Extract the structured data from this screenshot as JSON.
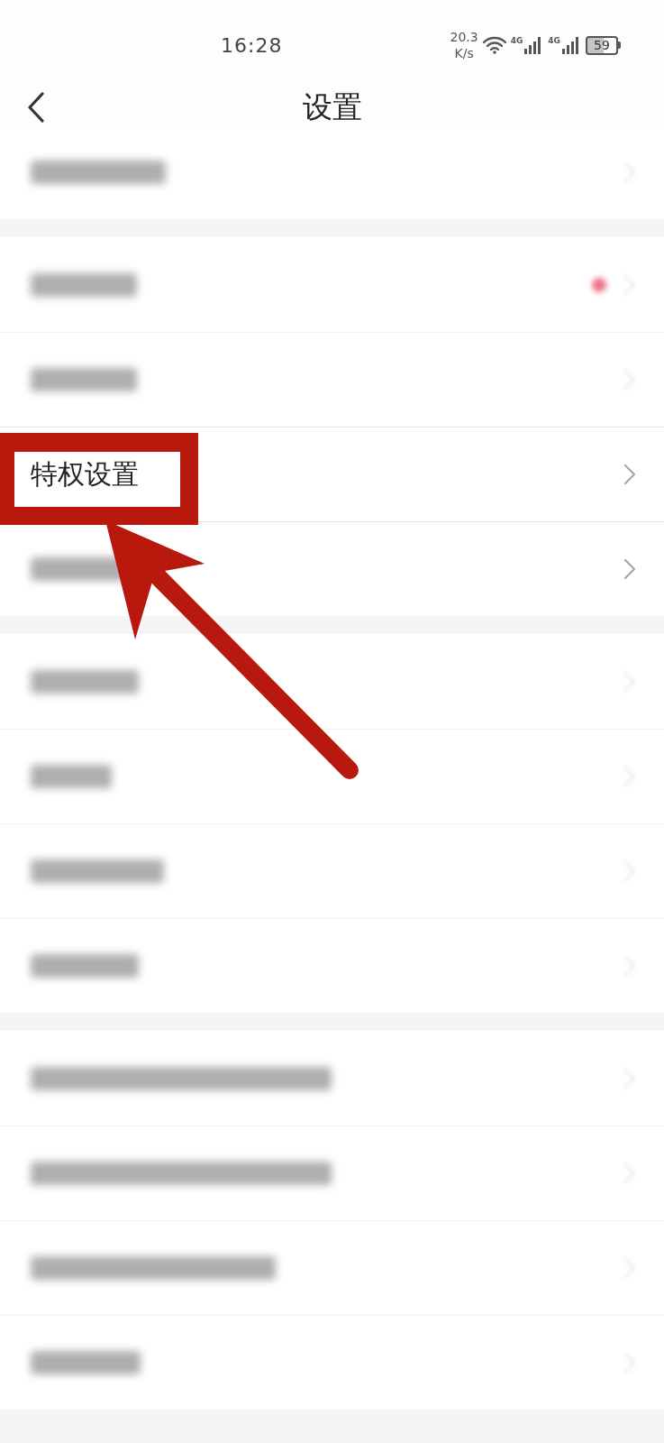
{
  "status_bar": {
    "time": "16:28",
    "network_speed": {
      "value": "20.3",
      "unit": "K/s"
    },
    "signals": [
      {
        "label": "4G"
      },
      {
        "label": "4G"
      }
    ],
    "battery": {
      "label": "59"
    }
  },
  "header": {
    "title": "设置"
  },
  "sections": [
    {
      "rows": [
        {
          "kind": "blurred",
          "dot": false,
          "chevron_blurred": true,
          "highlighted": false
        }
      ]
    },
    {
      "rows": [
        {
          "kind": "blurred",
          "dot": true,
          "chevron_blurred": true,
          "highlighted": false
        },
        {
          "kind": "blurred",
          "dot": false,
          "chevron_blurred": true,
          "highlighted": false
        },
        {
          "kind": "text",
          "label": "特权设置",
          "dot": false,
          "chevron_blurred": false,
          "highlighted": true
        },
        {
          "kind": "blurred",
          "dot": false,
          "chevron_blurred": false,
          "highlighted": false
        }
      ]
    },
    {
      "rows": [
        {
          "kind": "blurred",
          "dot": false,
          "chevron_blurred": true,
          "highlighted": false
        },
        {
          "kind": "blurred",
          "dot": false,
          "chevron_blurred": true,
          "highlighted": false
        },
        {
          "kind": "blurred",
          "dot": false,
          "chevron_blurred": true,
          "highlighted": false
        },
        {
          "kind": "blurred",
          "dot": false,
          "chevron_blurred": true,
          "highlighted": false
        }
      ]
    },
    {
      "rows": [
        {
          "kind": "blurred",
          "dot": false,
          "chevron_blurred": true,
          "highlighted": false
        },
        {
          "kind": "blurred",
          "dot": false,
          "chevron_blurred": true,
          "highlighted": false
        },
        {
          "kind": "blurred",
          "dot": false,
          "chevron_blurred": true,
          "highlighted": false
        },
        {
          "kind": "blurred",
          "dot": false,
          "chevron_blurred": true,
          "highlighted": false
        }
      ]
    }
  ]
}
